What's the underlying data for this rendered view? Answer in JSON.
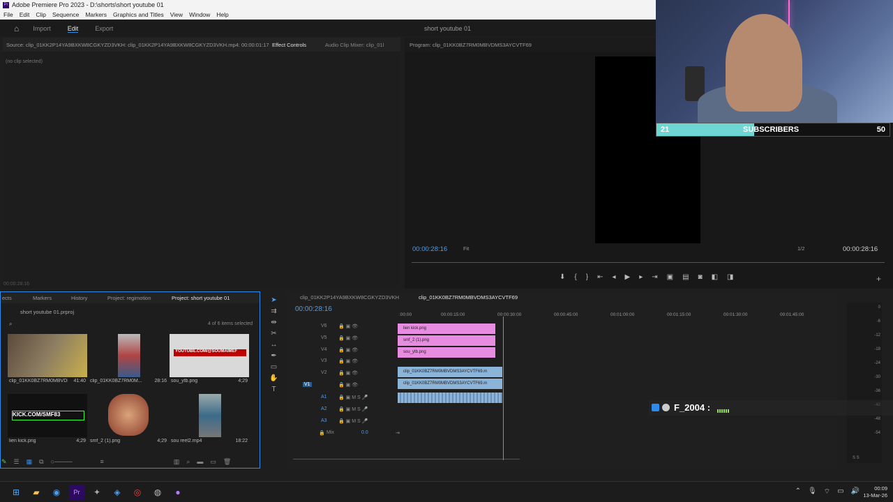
{
  "window": {
    "title": "Adobe Premiere Pro 2023 - D:\\shorts\\short youtube 01"
  },
  "menu": [
    "File",
    "Edit",
    "Clip",
    "Sequence",
    "Markers",
    "Graphics and Titles",
    "View",
    "Window",
    "Help"
  ],
  "workspace": {
    "import": "Import",
    "edit": "Edit",
    "export": "Export",
    "project_name": "short youtube 01"
  },
  "source": {
    "title": "Source: clip_01KK2P14YA9BXKW8CGKYZD3VKH: clip_01KK2P14YA9BXKW8CGKYZD3VKH.mp4: 00:00:01:17",
    "effect_controls": "Effect Controls",
    "audio_mixer": "Audio Clip Mixer: clip_01l",
    "no_clip": "(no clip selected)",
    "timecode": "00:00:28:16"
  },
  "program": {
    "title": "Program: clip_01KK0BZ7RM0MBVDMS3AYCVTF69",
    "timecode": "00:00:28:16",
    "fit": "Fit",
    "resolution": "1/2",
    "duration": "00:00:28:16"
  },
  "overlay": {
    "subs_current": "21",
    "subs_label": "SUBSCRIBERS",
    "subs_goal": "50",
    "subs_progress": 0.42,
    "chat_text": "F_2004 :"
  },
  "project": {
    "tabs": [
      "ects",
      "Markers",
      "History",
      "Project: regimotion",
      "Project: short youtube 01"
    ],
    "file": "short youtube 01.prproj",
    "selection": "4 of 6 items selected",
    "items": [
      {
        "name": "clip_01KK0BZ7RM0MBVDM...",
        "dur": "41:40"
      },
      {
        "name": "clip_01KK0BZ7RM0M...",
        "dur": "28:16"
      },
      {
        "name": "sou_ytb.png",
        "dur": "4;29"
      },
      {
        "name": "lien kick.png",
        "dur": "4;29"
      },
      {
        "name": "smf_2 (1).png",
        "dur": "4;29"
      },
      {
        "name": "sou reel2.mp4",
        "dur": "18:22"
      }
    ],
    "thumb_text": {
      "youtube": "YOUTUBE.COM/@SOUMAIMEF",
      "kick": "KICK.COM/SMF83"
    }
  },
  "timeline": {
    "tabs": [
      "clip_01KK2P14YA9BXKW8CGKYZD3VKH",
      "clip_01KK0BZ7RM0MBVDMS3AYCVTF69"
    ],
    "timecode": "00:00:28:16",
    "ticks": [
      ":00:00",
      "00:00:15:00",
      "00:00:30:00",
      "00:00:45:00",
      "00:01:00:00",
      "00:01:15:00",
      "00:01:30:00",
      "00:01:45:00"
    ],
    "tracks": [
      "V6",
      "V5",
      "V4",
      "V3",
      "V2",
      "V1",
      "A1",
      "A2",
      "A3",
      "Mix"
    ],
    "mix_value": "0.0",
    "clips": {
      "v6": "lien kick.png",
      "v5": "smf_2 (1).png",
      "v4": "sou_ytb.png",
      "v2": "clip_01KK0BZ7RM0MBVDMS3AYCVTF69.m",
      "v1": "clip_01KK0BZ7RM0MBVDMS3AYCVTF69.m"
    }
  },
  "meter": {
    "labels": [
      "0",
      "-6",
      "-12",
      "-18",
      "-24",
      "-30",
      "-36",
      "-42",
      "-48",
      "-54"
    ],
    "foot": "S  S"
  },
  "taskbar": {
    "time": "00:09",
    "date": "13-Mar-26"
  },
  "colors": {
    "accent": "#2d8ceb",
    "timecode": "#4a9ef0",
    "pink_clip": "#e78ce1",
    "blue_clip": "#8cb4d8",
    "subs_fill": "#6fd7d3"
  }
}
